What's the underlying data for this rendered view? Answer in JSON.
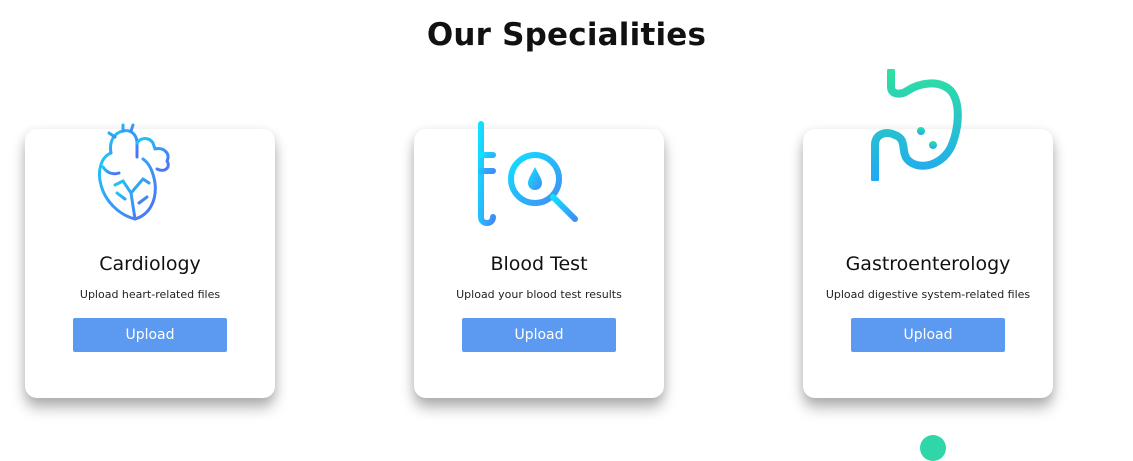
{
  "section": {
    "title": "Our Specialities"
  },
  "cards": [
    {
      "icon": "heart-icon",
      "title": "Cardiology",
      "description": "Upload heart-related files",
      "button_label": "Upload"
    },
    {
      "icon": "blood-test-icon",
      "title": "Blood Test",
      "description": "Upload your blood test results",
      "button_label": "Upload"
    },
    {
      "icon": "stomach-icon",
      "title": "Gastroenterology",
      "description": "Upload digestive system-related files",
      "button_label": "Upload"
    }
  ],
  "colors": {
    "button": "#5c9af2",
    "icon_gradient_blue": "#3f7ef7",
    "icon_gradient_cyan": "#1ec8f5",
    "icon_gradient_green": "#2fe0a0"
  }
}
